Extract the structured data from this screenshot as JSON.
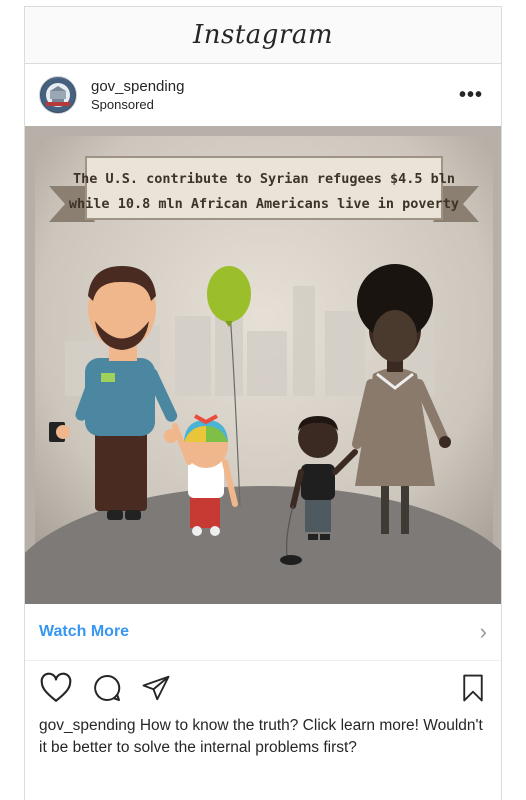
{
  "app": {
    "title": "Instagram"
  },
  "post": {
    "username": "gov_spending",
    "label": "Sponsored",
    "more_label": "•••",
    "image": {
      "banner_line1": "The U.S. contribute to Syrian refugees $4.5 bln",
      "banner_line2": "while 10.8 mln African Americans live in poverty"
    },
    "cta": {
      "label": "Watch More",
      "chevron": "›"
    },
    "actions": [
      "heart-icon",
      "comment-icon",
      "share-icon",
      "bookmark-icon"
    ],
    "caption_user": "gov_spending",
    "caption_text": "How to know the truth? Click learn more! Wouldn't it be better to solve the internal problems first?"
  },
  "colors": {
    "link": "#3897f0",
    "border": "#dbdbdb"
  }
}
